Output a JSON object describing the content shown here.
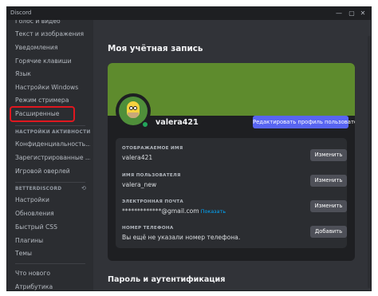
{
  "titlebar": {
    "app_name": "Discord",
    "min": "—",
    "max": "▢",
    "close": "✕"
  },
  "sidebar": {
    "items_top": [
      "Голос и видео",
      "Текст и изображения",
      "Уведомления",
      "Горячие клавиши",
      "Язык",
      "Настройки Windows",
      "Режим стримера",
      "Расширенные"
    ],
    "activity_header": "НАСТРОЙКИ АКТИВНОСТИ",
    "items_activity": [
      "Конфиденциальность...",
      "Зарегистрированные ...",
      "Игровой оверлей"
    ],
    "bd_header": "BETTERDISCORD",
    "items_bd": [
      "Настройки",
      "Обновления",
      "Быстрый CSS",
      "Плагины",
      "Темы"
    ],
    "items_bottom": [
      "Что нового",
      "Атрибутика"
    ]
  },
  "main": {
    "title": "Моя учётная запись",
    "username": "valera421",
    "more": "···",
    "edit_profile_label": "Редактировать профиль пользователя",
    "fields": [
      {
        "label": "ОТОБРАЖАЕМОЕ ИМЯ",
        "value": "valera421",
        "button": "Изменить"
      },
      {
        "label": "ИМЯ ПОЛЬЗОВАТЕЛЯ",
        "value": "valera_new",
        "button": "Изменить"
      },
      {
        "label": "ЭЛЕКТРОННАЯ ПОЧТА",
        "value": "*************@gmail.com",
        "link": "Показать",
        "button": "Изменить"
      },
      {
        "label": "НОМЕР ТЕЛЕФОНА",
        "value": "Вы ещё не указали номер телефона.",
        "button": "Добавить"
      }
    ],
    "section2_title": "Пароль и аутентификация"
  },
  "colors": {
    "banner": "#5e8b2d",
    "accent": "#5865f2",
    "status_online": "#23a55a",
    "highlight": "#e0171f"
  }
}
